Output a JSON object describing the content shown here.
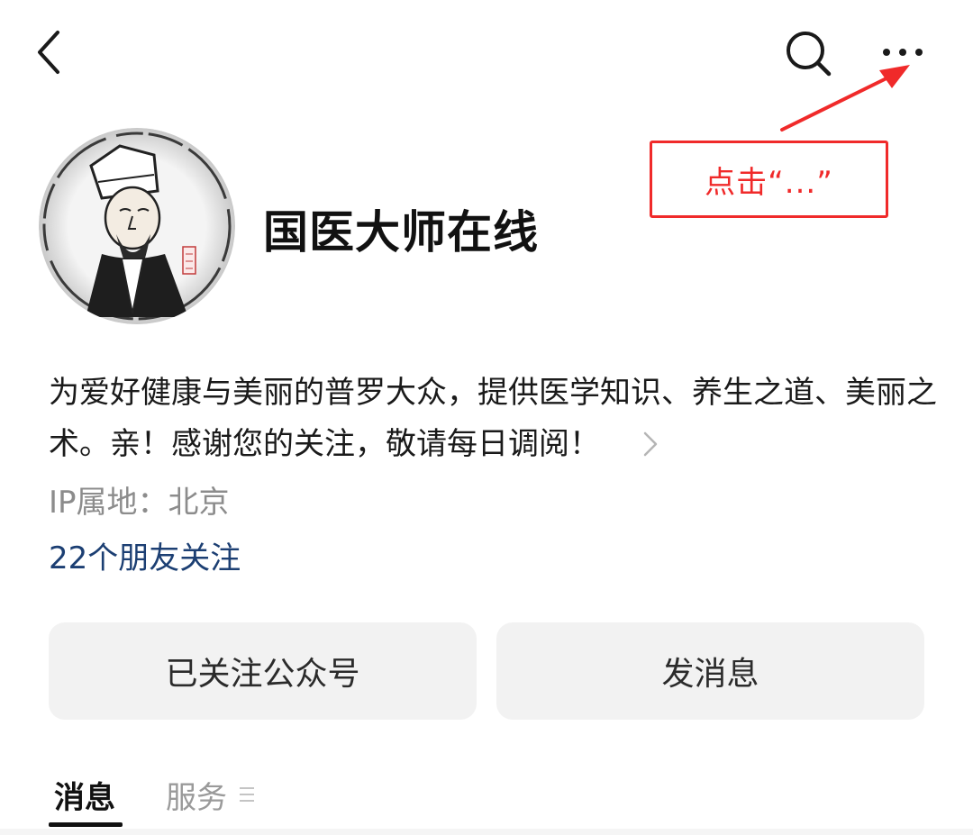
{
  "header": {
    "back_icon": "chevron-left-icon",
    "search_icon": "search-icon",
    "more_icon": "more-dots-icon"
  },
  "annotation": {
    "text": "点击“...”",
    "color": "#f02a2a"
  },
  "profile": {
    "name": "国医大师在线",
    "description": "为爱好健康与美丽的普罗大众，提供医学知识、养生之道、美丽之术。亲！感谢您的关注，敬请每日调阅！",
    "ip_location": "IP属地：北京",
    "friends_following": "22个朋友关注"
  },
  "actions": {
    "followed_label": "已关注公众号",
    "message_label": "发消息"
  },
  "tabs": {
    "messages": "消息",
    "services": "服务",
    "active": "消息"
  },
  "colors": {
    "link": "#1c3f73",
    "muted": "#8c8c8c",
    "button_bg": "#f2f2f2"
  }
}
